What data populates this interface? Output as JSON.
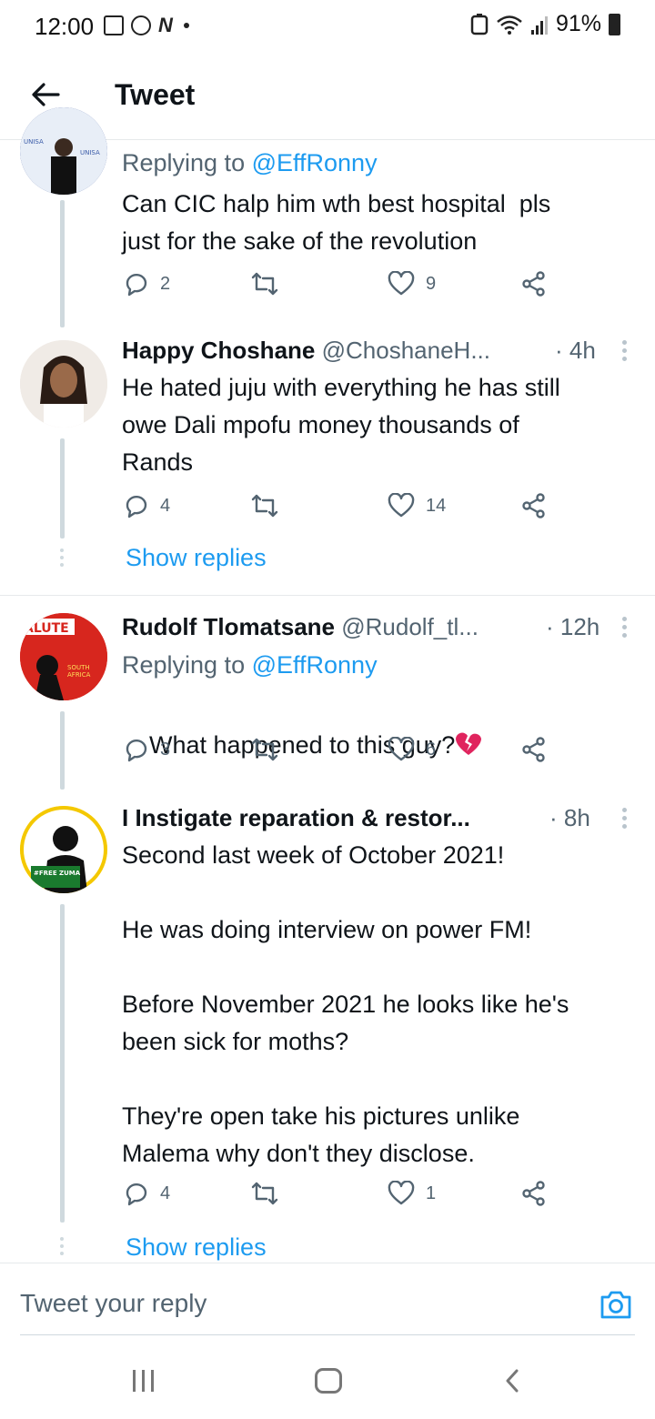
{
  "status_bar": {
    "time": "12:00",
    "battery": "91%"
  },
  "header": {
    "title": "Tweet"
  },
  "tweets": [
    {
      "reply_prefix": "Replying to ",
      "reply_handle": "@EffRonny",
      "text": "Can CIC halp him wth best hospital  pls\njust for the sake of the revolution",
      "replies": "2",
      "likes": "9"
    },
    {
      "name": "Happy Choshane",
      "handle": "@ChoshaneH...",
      "time": "· 4h",
      "text": "He hated juju with everything he has still\nowe Dali mpofu money thousands of\nRands",
      "replies": "4",
      "likes": "14",
      "show_replies": "Show replies"
    },
    {
      "name": "Rudolf Tlomatsane",
      "handle": "@Rudolf_tl...",
      "time": "· 12h",
      "reply_prefix": "Replying to ",
      "reply_handle": "@EffRonny",
      "text": "What happened to this guy?",
      "replies": "3",
      "likes": "6",
      "avatar_text": "ALUTE"
    },
    {
      "name": "I Instigate reparation & restor...",
      "time": "· 8h",
      "text": "Second last week of October 2021!\n\nHe was doing interview on power FM!\n\nBefore November 2021 he looks like he's\nbeen sick for moths?\n\nThey're open take his pictures unlike\nMalema why don't they disclose.",
      "replies": "4",
      "likes": "1",
      "show_replies": "Show replies",
      "avatar_badge": "#FREE ZUMA"
    }
  ],
  "reply_bar": {
    "placeholder": "Tweet your reply"
  },
  "colors": {
    "accent": "#1d9bf0",
    "secondary_text": "#536471",
    "heart_broken": "#e0245e"
  }
}
